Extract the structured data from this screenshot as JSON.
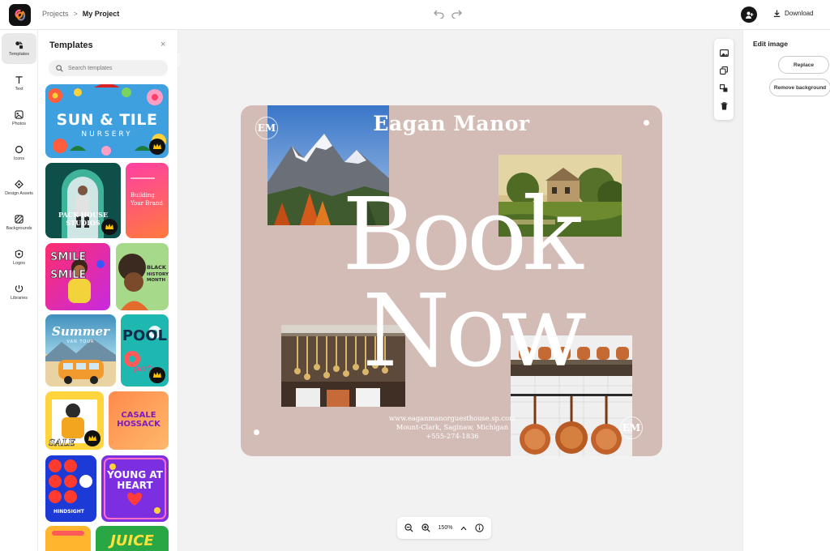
{
  "app": {
    "breadcrumb": {
      "root": "Projects",
      "separator": ">",
      "current": "My Project"
    },
    "download_label": "Download",
    "accent": "#000000"
  },
  "rail": {
    "items": [
      {
        "label": "Templates",
        "icon": "templates-icon",
        "active": true
      },
      {
        "label": "Text",
        "icon": "text-icon"
      },
      {
        "label": "Photos",
        "icon": "photos-icon"
      },
      {
        "label": "Icons",
        "icon": "shapes-icon"
      },
      {
        "label": "Design Assets",
        "icon": "design-assets-icon"
      },
      {
        "label": "Backgrounds",
        "icon": "backgrounds-icon"
      },
      {
        "label": "Logos",
        "icon": "logos-icon"
      },
      {
        "label": "Libraries",
        "icon": "libraries-icon"
      }
    ]
  },
  "panel": {
    "title": "Templates",
    "close": "×",
    "search_placeholder": "Search templates",
    "templates": [
      {
        "heading": "SUN & TILE",
        "sub": "NURSERY",
        "premium": true
      },
      {
        "heading": "PACK HOUSE",
        "sub": "STUDIOS",
        "premium": true
      },
      {
        "heading": "Building",
        "sub": "Your Brand"
      },
      {
        "heading": "SMILE",
        "sub": "SMILE",
        "premium": false
      },
      {
        "heading": "BLACK",
        "sub": "HISTORY MONTH"
      },
      {
        "heading": "Summer",
        "sub": "VAN TOUR"
      },
      {
        "heading": "POOL",
        "sub": "party",
        "premium": true
      },
      {
        "heading": "SALE",
        "sub": "",
        "premium": true
      },
      {
        "heading": "CASALE",
        "sub": "HOSSACK"
      },
      {
        "heading": "HINDSIGHT",
        "sub": ""
      },
      {
        "heading": "YOUNG AT",
        "sub": "HEART"
      },
      {
        "heading": "JUICE",
        "sub": ""
      }
    ]
  },
  "artboard": {
    "title": "Eagan Manor",
    "monogram_left": "EM",
    "monogram_right": "EM",
    "word1": "Book",
    "word2": "Now",
    "website": "www.eaganmanorguesthouse.sp.com",
    "address": "Mount-Clark, Saginaw, Michigan",
    "phone": "+555-274-1836",
    "background": "#d4bcb6"
  },
  "zoom": {
    "level": "150%"
  },
  "right_panel": {
    "title": "Edit image",
    "replace_label": "Replace",
    "remove_bg_label": "Remove background"
  }
}
